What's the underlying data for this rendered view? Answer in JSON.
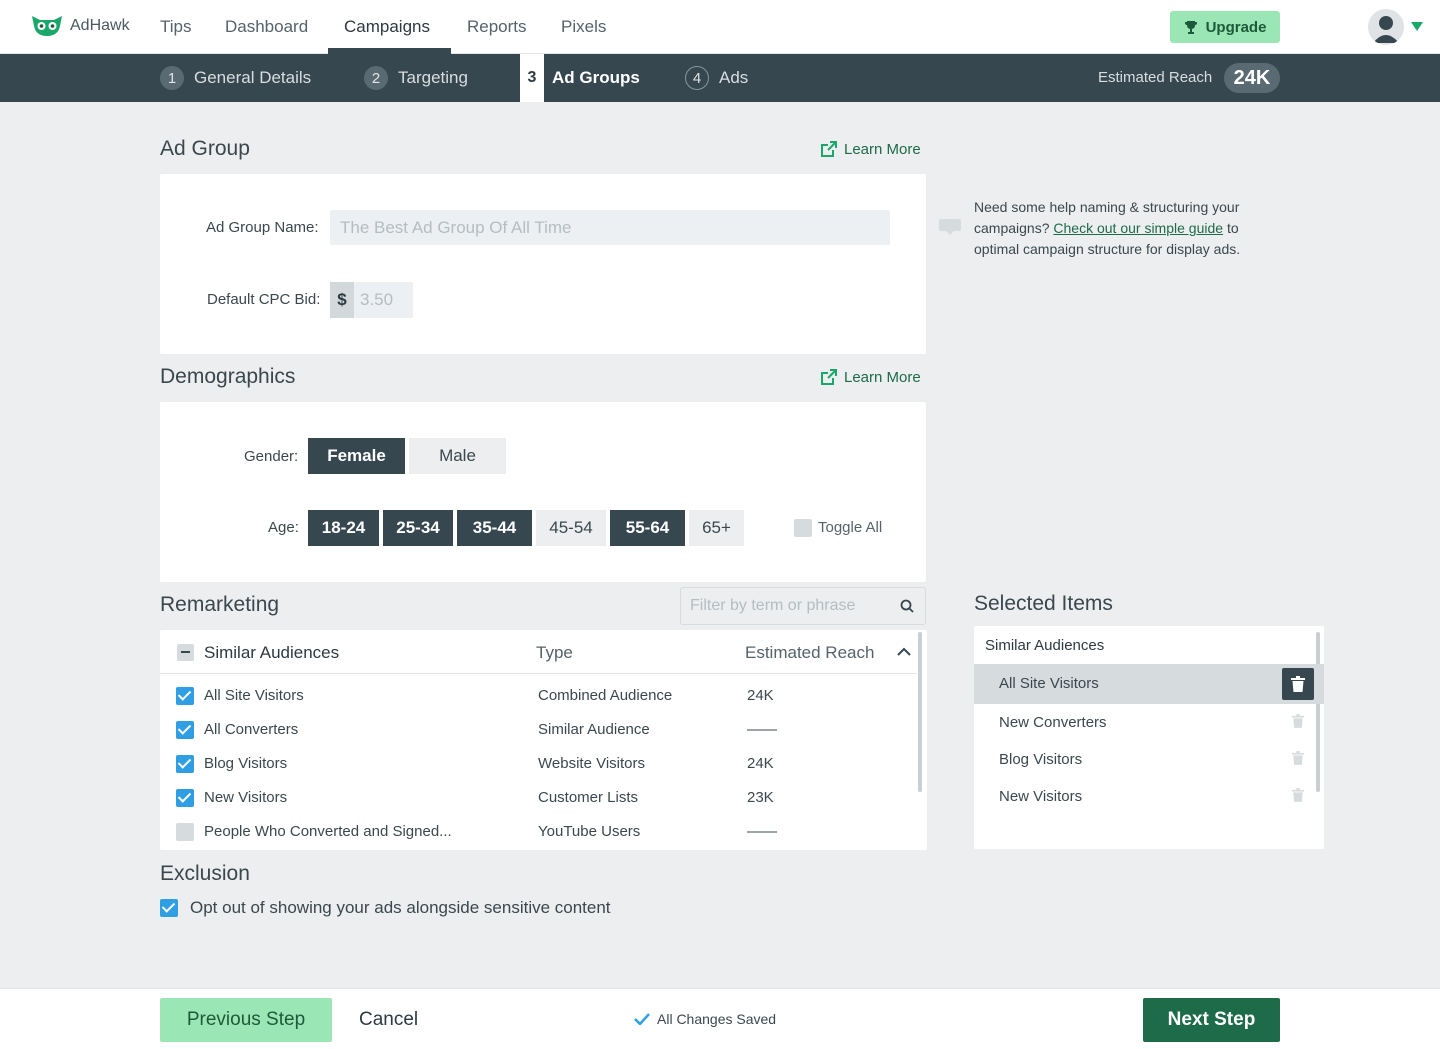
{
  "app": {
    "name": "AdHawk"
  },
  "nav": {
    "links": [
      "Tips",
      "Dashboard",
      "Campaigns",
      "Reports",
      "Pixels"
    ],
    "upgrade_label": "Upgrade"
  },
  "steps": {
    "items": [
      {
        "num": "1",
        "label": "General Details"
      },
      {
        "num": "2",
        "label": "Targeting"
      },
      {
        "num": "3",
        "label": "Ad Groups"
      },
      {
        "num": "4",
        "label": "Ads"
      }
    ],
    "reach_label": "Estimated Reach",
    "reach_value": "24K"
  },
  "ad_group": {
    "title": "Ad Group",
    "learn_more": "Learn More",
    "name_label": "Ad Group Name:",
    "name_placeholder": "The Best Ad Group Of All Time",
    "cpc_label": "Default CPC Bid:",
    "cpc_prefix": "$",
    "cpc_placeholder": "3.50"
  },
  "help": {
    "text_before": "Need some help naming & structuring your campaigns?",
    "link": "Check out our simple guide",
    "text_after": "to optimal campaign structure for display ads."
  },
  "demographics": {
    "title": "Demographics",
    "learn_more": "Learn More",
    "gender_label": "Gender:",
    "genders": [
      {
        "label": "Female",
        "selected": true
      },
      {
        "label": "Male",
        "selected": false
      }
    ],
    "age_label": "Age:",
    "ages": [
      {
        "label": "18-24",
        "selected": true
      },
      {
        "label": "25-34",
        "selected": true
      },
      {
        "label": "35-44",
        "selected": true
      },
      {
        "label": "45-54",
        "selected": false
      },
      {
        "label": "55-64",
        "selected": true
      },
      {
        "label": "65+",
        "selected": false
      }
    ],
    "toggle_all": "Toggle All"
  },
  "remarketing": {
    "title": "Remarketing",
    "filter_placeholder": "Filter by term or phrase",
    "group_label": "Similar Audiences",
    "col_type": "Type",
    "col_reach": "Estimated Reach",
    "rows": [
      {
        "name": "All Site Visitors",
        "type": "Combined Audience",
        "reach": "24K",
        "checked": true
      },
      {
        "name": "All Converters",
        "type": "Similar Audience",
        "reach": "——",
        "checked": true
      },
      {
        "name": "Blog Visitors",
        "type": "Website Visitors",
        "reach": "24K",
        "checked": true
      },
      {
        "name": "New Visitors",
        "type": "Customer Lists",
        "reach": "23K",
        "checked": true
      },
      {
        "name": "People Who Converted and Signed...",
        "type": "YouTube Users",
        "reach": "——",
        "checked": false
      }
    ]
  },
  "selected": {
    "title": "Selected Items",
    "group": "Similar Audiences",
    "items": [
      "All Site Visitors",
      "New Converters",
      "Blog Visitors",
      "New Visitors"
    ]
  },
  "exclusion": {
    "title": "Exclusion",
    "option": "Opt out of showing your ads alongside sensitive content"
  },
  "footer": {
    "prev": "Previous Step",
    "cancel": "Cancel",
    "saved": "All Changes Saved",
    "next": "Next Step"
  },
  "colors": {
    "accent": "#1e6b4a",
    "accent_light": "#9ae6b4",
    "dark": "#36474f",
    "check": "#2f9ee3"
  }
}
